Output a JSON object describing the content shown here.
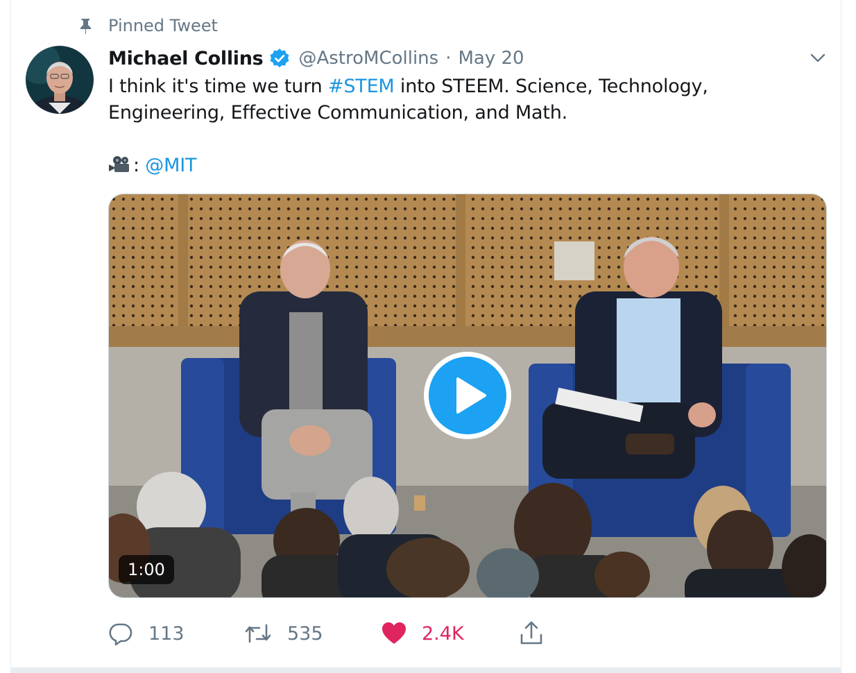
{
  "pinned": {
    "label": "Pinned Tweet"
  },
  "tweet": {
    "author_name": "Michael Collins",
    "handle": "@AstroMCollins",
    "separator": "·",
    "date": "May 20",
    "line1_before": "I think it's time we turn ",
    "hashtag": "#STEM",
    "line1_after": " into STEEM. Science, Technology,",
    "line2": "Engineering, Effective Communication, and Math.",
    "credit_separator": ":",
    "credit_mention": "@MIT"
  },
  "media": {
    "duration": "1:00"
  },
  "actions": {
    "replies": "113",
    "retweets": "535",
    "likes": "2.4K"
  },
  "icons": {
    "pin": "pin-icon",
    "verified": "verified-badge-icon",
    "caret": "chevron-down-icon",
    "camera": "movie-camera-icon",
    "play": "play-icon",
    "reply": "reply-icon",
    "retweet": "retweet-icon",
    "like": "heart-icon",
    "share": "share-icon"
  },
  "colors": {
    "link": "#1b95e0",
    "secondary_text": "#657786",
    "primary_text": "#14171a",
    "like": "#e0245e",
    "verified": "#1da1f2"
  }
}
